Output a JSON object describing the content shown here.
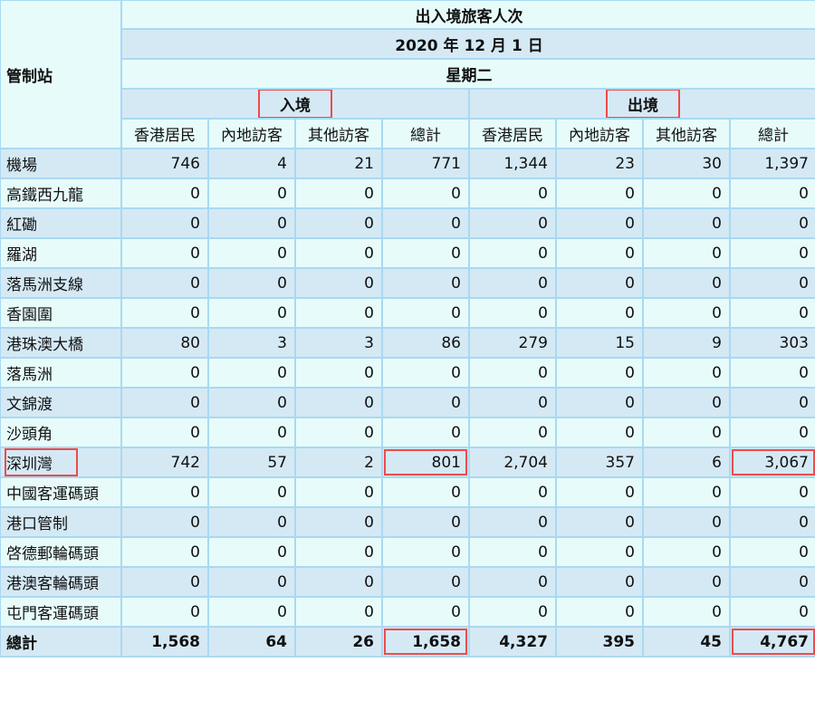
{
  "table": {
    "station_header": "管制站",
    "title": "出入境旅客人次",
    "date": "2020 年 12 月 1 日",
    "weekday": "星期二",
    "groups": [
      {
        "label": "入境",
        "highlighted": true
      },
      {
        "label": "出境",
        "highlighted": true
      }
    ],
    "subcolumns": [
      "香港居民",
      "內地訪客",
      "其他訪客",
      "總計",
      "香港居民",
      "內地訪客",
      "其他訪客",
      "總計"
    ],
    "rows": [
      {
        "name": "機場",
        "values": [
          "746",
          "4",
          "21",
          "771",
          "1,344",
          "23",
          "30",
          "1,397"
        ]
      },
      {
        "name": "高鐵西九龍",
        "values": [
          "0",
          "0",
          "0",
          "0",
          "0",
          "0",
          "0",
          "0"
        ]
      },
      {
        "name": "紅磡",
        "values": [
          "0",
          "0",
          "0",
          "0",
          "0",
          "0",
          "0",
          "0"
        ]
      },
      {
        "name": "羅湖",
        "values": [
          "0",
          "0",
          "0",
          "0",
          "0",
          "0",
          "0",
          "0"
        ]
      },
      {
        "name": "落馬洲支線",
        "values": [
          "0",
          "0",
          "0",
          "0",
          "0",
          "0",
          "0",
          "0"
        ]
      },
      {
        "name": "香園圍",
        "values": [
          "0",
          "0",
          "0",
          "0",
          "0",
          "0",
          "0",
          "0"
        ]
      },
      {
        "name": "港珠澳大橋",
        "values": [
          "80",
          "3",
          "3",
          "86",
          "279",
          "15",
          "9",
          "303"
        ]
      },
      {
        "name": "落馬洲",
        "values": [
          "0",
          "0",
          "0",
          "0",
          "0",
          "0",
          "0",
          "0"
        ]
      },
      {
        "name": "文錦渡",
        "values": [
          "0",
          "0",
          "0",
          "0",
          "0",
          "0",
          "0",
          "0"
        ]
      },
      {
        "name": "沙頭角",
        "values": [
          "0",
          "0",
          "0",
          "0",
          "0",
          "0",
          "0",
          "0"
        ]
      },
      {
        "name": "深圳灣",
        "values": [
          "742",
          "57",
          "2",
          "801",
          "2,704",
          "357",
          "6",
          "3,067"
        ]
      },
      {
        "name": "中國客運碼頭",
        "values": [
          "0",
          "0",
          "0",
          "0",
          "0",
          "0",
          "0",
          "0"
        ]
      },
      {
        "name": "港口管制",
        "values": [
          "0",
          "0",
          "0",
          "0",
          "0",
          "0",
          "0",
          "0"
        ]
      },
      {
        "name": "啓德郵輪碼頭",
        "values": [
          "0",
          "0",
          "0",
          "0",
          "0",
          "0",
          "0",
          "0"
        ]
      },
      {
        "name": "港澳客輪碼頭",
        "values": [
          "0",
          "0",
          "0",
          "0",
          "0",
          "0",
          "0",
          "0"
        ]
      },
      {
        "name": "屯門客運碼頭",
        "values": [
          "0",
          "0",
          "0",
          "0",
          "0",
          "0",
          "0",
          "0"
        ]
      }
    ],
    "total": {
      "name": "總計",
      "values": [
        "1,568",
        "64",
        "26",
        "1,658",
        "4,327",
        "395",
        "45",
        "4,767"
      ]
    }
  },
  "colors": {
    "row_light": "#e7fcfa",
    "row_dark": "#d5e9f5",
    "border": "#a9d9f2",
    "highlight": "#ee4b4b"
  }
}
